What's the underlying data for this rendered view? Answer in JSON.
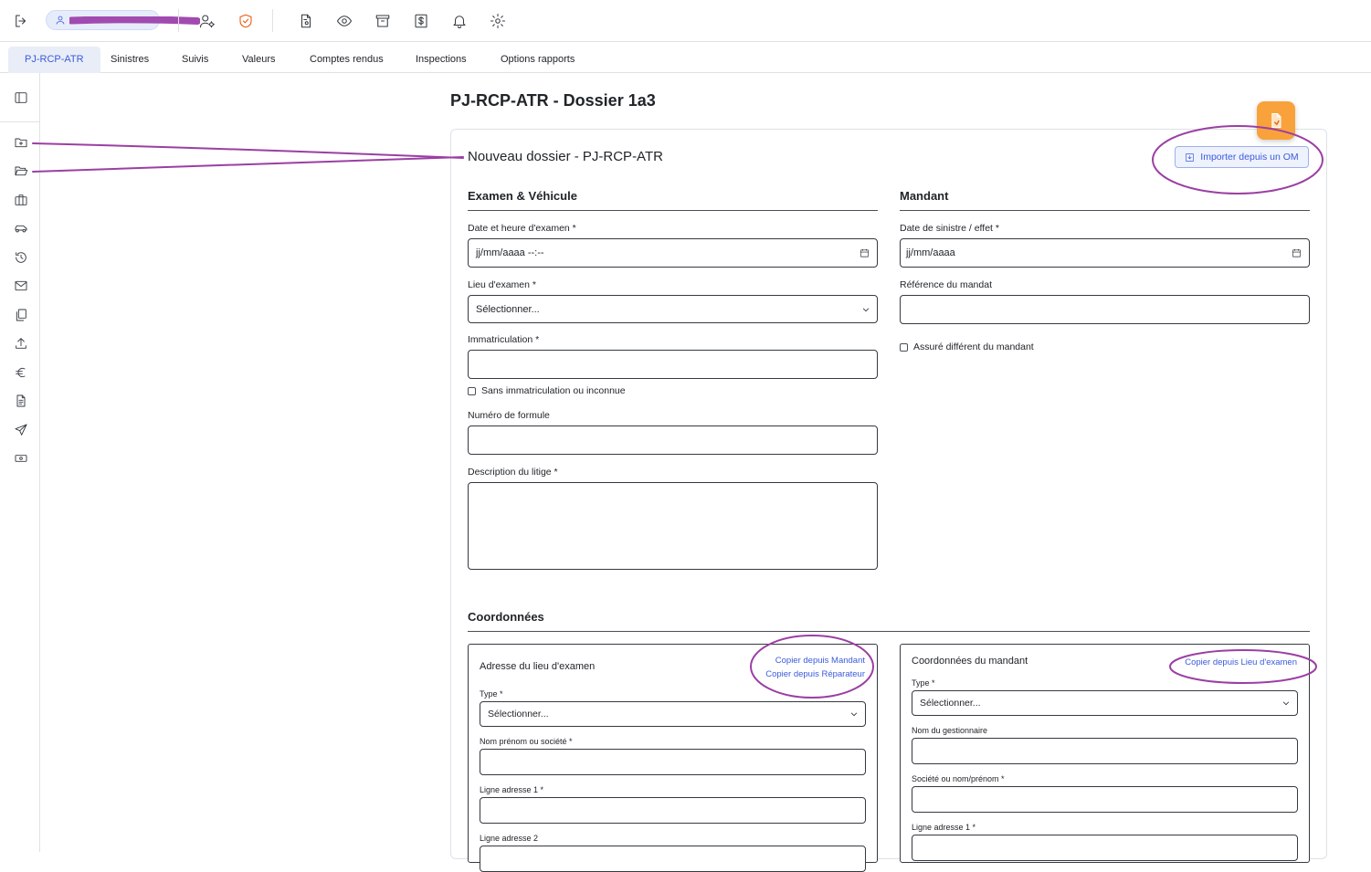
{
  "topbar": {
    "icons": [
      "logout-icon",
      "user-settings-icon",
      "shield-check-icon",
      "document-settings-icon",
      "eye-icon",
      "archive-icon",
      "dollar-file-icon",
      "bell-icon",
      "gear-icon"
    ]
  },
  "tabs": [
    {
      "label": "PJ-RCP-ATR",
      "active": true
    },
    {
      "label": "Sinistres"
    },
    {
      "label": "Suivis"
    },
    {
      "label": "Valeurs"
    },
    {
      "label": "Comptes rendus"
    },
    {
      "label": "Inspections"
    },
    {
      "label": "Options rapports"
    }
  ],
  "sidebar": {
    "icons": [
      "sidebar-toggle-icon",
      "folder-plus-icon",
      "folder-open-icon",
      "briefcase-icon",
      "car-icon",
      "history-icon",
      "mail-icon",
      "copy-icon",
      "upload-icon",
      "euro-icon",
      "file-text-icon",
      "send-icon",
      "cash-icon"
    ]
  },
  "page": {
    "title": "PJ-RCP-ATR - Dossier 1a3"
  },
  "form": {
    "title": "Nouveau dossier - PJ-RCP-ATR",
    "import_label": "Importer depuis un OM",
    "examen": {
      "title": "Examen & Véhicule",
      "date_label": "Date et heure d'examen *",
      "date_placeholder": "jj/mm/aaaa --:--",
      "lieu_label": "Lieu d'examen *",
      "lieu_value": "Sélectionner...",
      "immat_label": "Immatriculation *",
      "sans_immat_label": "Sans immatriculation ou inconnue",
      "formule_label": "Numéro de formule",
      "description_label": "Description du litige *"
    },
    "mandant": {
      "title": "Mandant",
      "date_label": "Date de sinistre / effet *",
      "date_placeholder": "jj/mm/aaaa",
      "reference_label": "Référence du mandat",
      "assure_label": "Assuré différent du mandant"
    },
    "coordonnees": {
      "title": "Coordonnées",
      "adresse": {
        "title": "Adresse du lieu d'examen",
        "copy_mandant": "Copier depuis Mandant",
        "copy_reparateur": "Copier depuis Réparateur",
        "type_label": "Type *",
        "type_value": "Sélectionner...",
        "nom_label": "Nom prénom ou société *",
        "ligne1_label": "Ligne adresse 1 *",
        "ligne2_label": "Ligne adresse 2"
      },
      "mandant": {
        "title": "Coordonnées du mandant",
        "copy_lieu": "Copier depuis Lieu d'examen",
        "type_label": "Type *",
        "type_value": "Sélectionner...",
        "gestionnaire_label": "Nom du gestionnaire",
        "societe_label": "Société ou nom/prénom *",
        "ligne1_label": "Ligne adresse 1 *"
      }
    }
  },
  "colors": {
    "accent": "#3b5bdb",
    "annotation": "#9b3fa3",
    "fab": "#f9a23c"
  }
}
